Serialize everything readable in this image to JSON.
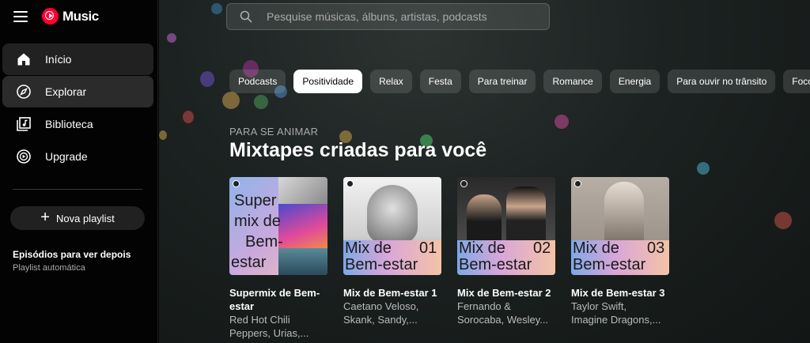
{
  "app": {
    "logo_text": "Music"
  },
  "sidebar": {
    "items": [
      {
        "label": "Início",
        "icon": "home-icon"
      },
      {
        "label": "Explorar",
        "icon": "compass-icon"
      },
      {
        "label": "Biblioteca",
        "icon": "library-icon"
      },
      {
        "label": "Upgrade",
        "icon": "upgrade-icon"
      }
    ],
    "new_playlist_label": "Nova playlist",
    "playlist": {
      "title": "Episódios para ver depois",
      "subtitle": "Playlist automática"
    }
  },
  "search": {
    "placeholder": "Pesquise músicas, álbuns, artistas, podcasts"
  },
  "chips": [
    "Podcasts",
    "Positividade",
    "Relax",
    "Festa",
    "Para treinar",
    "Romance",
    "Energia",
    "Para ouvir no trânsito",
    "Foco"
  ],
  "selected_chip": "Positividade",
  "section": {
    "eyebrow": "PARA SE ANIMAR",
    "title": "Mixtapes criadas para você",
    "cards": [
      {
        "thumb_lines": [
          "Super",
          "mix de",
          "Bem-",
          "estar"
        ],
        "title_1": "Supermix de Bem-",
        "title_2": "estar",
        "sub_1": "Red Hot Chili",
        "sub_2": "Peppers, Urias,..."
      },
      {
        "thumb_lines": [
          "Mix de",
          "Bem-estar"
        ],
        "thumb_number": "01",
        "title_1": "Mix de Bem-estar 1",
        "title_2": "",
        "sub_1": "Caetano Veloso,",
        "sub_2": "Skank, Sandy,..."
      },
      {
        "thumb_lines": [
          "Mix de",
          "Bem-estar"
        ],
        "thumb_number": "02",
        "title_1": "Mix de Bem-estar 2",
        "title_2": "",
        "sub_1": "Fernando &",
        "sub_2": "Sorocaba, Wesley..."
      },
      {
        "thumb_lines": [
          "Mix de",
          "Bem-estar"
        ],
        "thumb_number": "03",
        "title_1": "Mix de Bem-estar 3",
        "title_2": "",
        "sub_1": "Taylor Swift,",
        "sub_2": "Imagine Dragons,..."
      }
    ]
  },
  "colors": {
    "accent": "#ff0033",
    "sidebar_bg": "#030303",
    "active_nav": "#212121"
  }
}
